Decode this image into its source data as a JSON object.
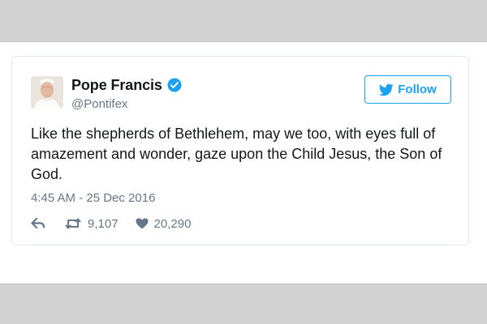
{
  "tweet": {
    "author_name": "Pope Francis",
    "handle": "@Pontifex",
    "verified": true,
    "follow_label": "Follow",
    "text": "Like the shepherds of Bethlehem, may we too, with eyes full of amazement and wonder, gaze upon the Child Jesus, the Son of God.",
    "timestamp": "4:45 AM - 25 Dec 2016",
    "retweets": "9,107",
    "likes": "20,290"
  },
  "icons": {
    "verified": "verified-badge-icon",
    "follow": "twitter-bird-icon",
    "reply": "reply-icon",
    "retweet": "retweet-icon",
    "like": "heart-icon"
  },
  "colors": {
    "accent": "#1da1f2",
    "text": "#14171a",
    "muted": "#657786",
    "band": "#d3d3d3"
  }
}
